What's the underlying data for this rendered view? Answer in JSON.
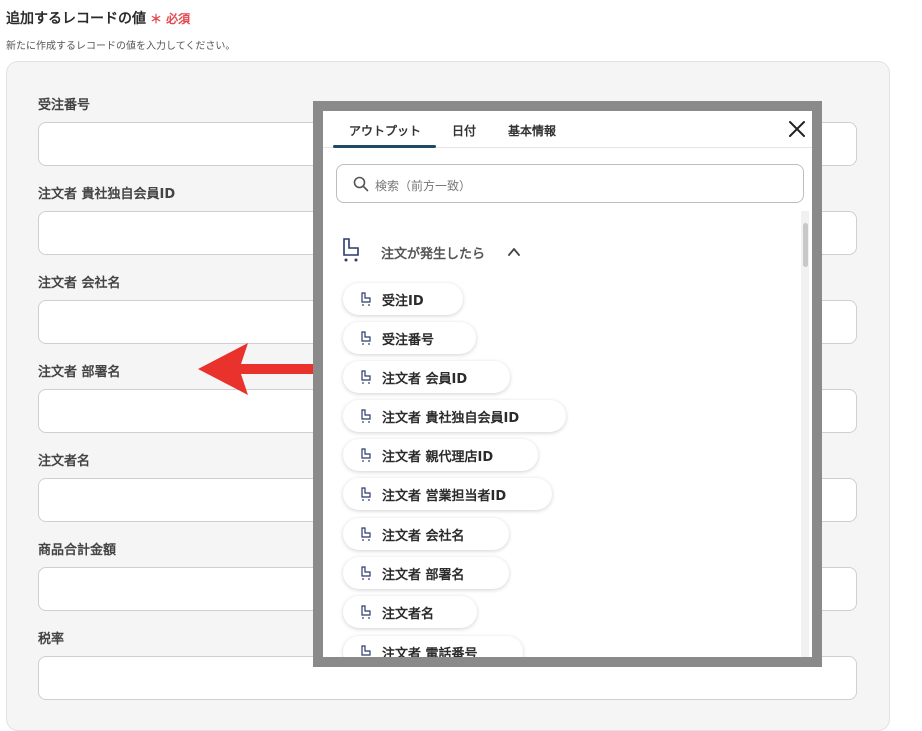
{
  "section": {
    "title": "追加するレコードの値",
    "required": "＊ 必須",
    "description": "新たに作成するレコードの値を入力してください。"
  },
  "fields": [
    {
      "label": "受注番号"
    },
    {
      "label": "注文者 貴社独自会員ID"
    },
    {
      "label": "注文者 会社名"
    },
    {
      "label": "注文者 部署名"
    },
    {
      "label": "注文者名"
    },
    {
      "label": "商品合計金額"
    },
    {
      "label": "税率"
    }
  ],
  "popup": {
    "tabs": [
      "アウトプット",
      "日付",
      "基本情報"
    ],
    "active_tab": "アウトプット",
    "search_placeholder": "検索（前方一致）",
    "group_label": "注文が発生したら",
    "items": [
      "受注ID",
      "受注番号",
      "注文者 会員ID",
      "注文者 貴社独自会員ID",
      "注文者 親代理店ID",
      "注文者 営業担当者ID",
      "注文者 会社名",
      "注文者 部署名",
      "注文者名",
      "注文者 電話番号"
    ]
  },
  "icons": {
    "close": "close-icon",
    "search": "search-icon",
    "group": "cart-icon",
    "item": "cart-icon",
    "collapse": "chevron-up-icon",
    "annotation": "red-arrow-icon"
  },
  "colors": {
    "required": "#e5484d",
    "tab_underline": "#1f4a63",
    "arrow": "#e8322b",
    "frame": "#8a8a8a"
  }
}
